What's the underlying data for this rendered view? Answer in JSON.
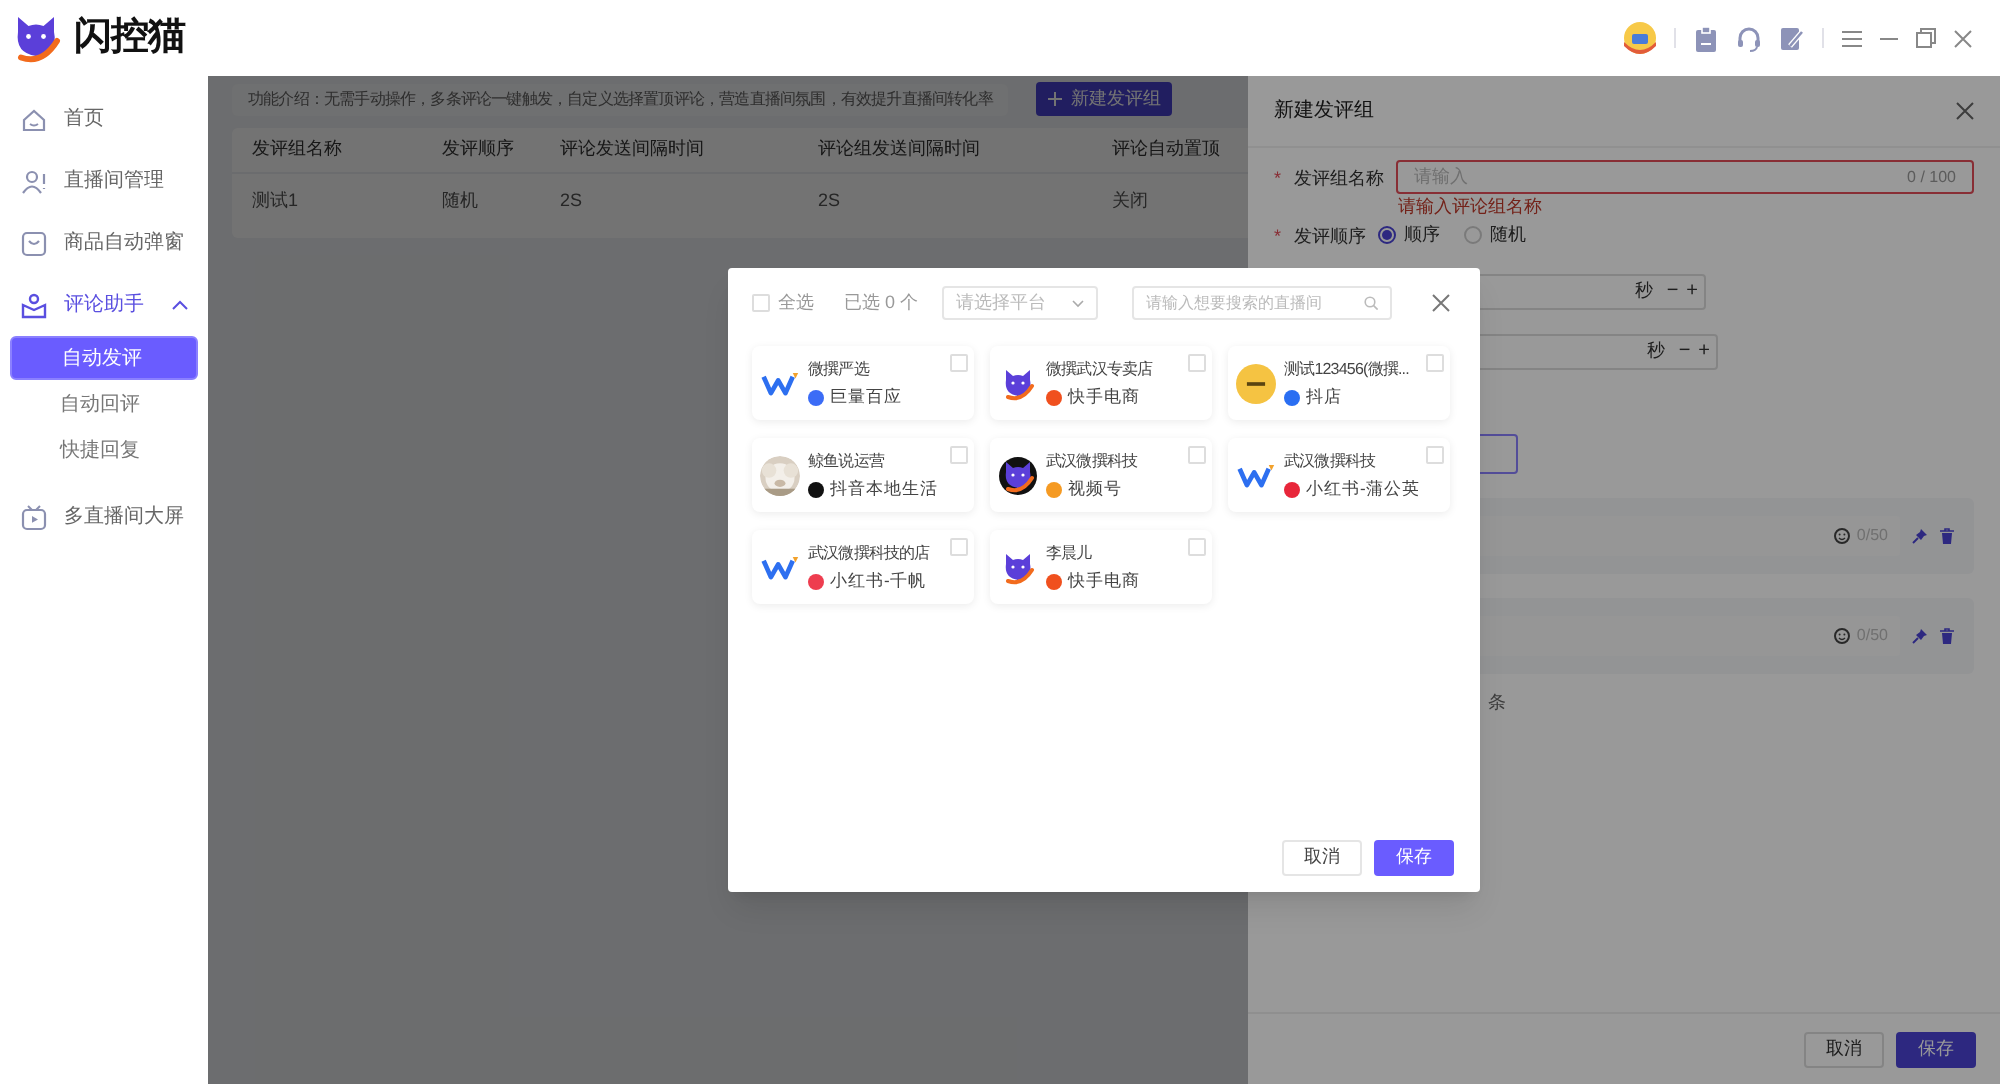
{
  "app": {
    "name": "闪控猫"
  },
  "sidebar": {
    "items": [
      {
        "label": "首页",
        "kind": "link",
        "selected": false
      },
      {
        "label": "直播间管理",
        "kind": "link",
        "selected": false
      },
      {
        "label": "商品自动弹窗",
        "kind": "link",
        "selected": false
      },
      {
        "label": "评论助手",
        "kind": "group",
        "expanded": true,
        "selected": false,
        "children": [
          {
            "label": "自动发评",
            "selected": true
          },
          {
            "label": "自动回评",
            "selected": false
          },
          {
            "label": "快捷回复",
            "selected": false
          }
        ]
      },
      {
        "label": "多直播间大屏",
        "kind": "link",
        "selected": false
      }
    ]
  },
  "main": {
    "notice": "功能介绍：无需手动操作，多条评论一键触发，自定义选择置顶评论，营造直播间氛围，有效提升直播间转化率",
    "new_button": "新建发评组",
    "table": {
      "columns": [
        "发评组名称",
        "发评顺序",
        "评论发送间隔时间",
        "评论组发送间隔时间",
        "评论自动置顶"
      ],
      "rows": [
        [
          "测试1",
          "随机",
          "2S",
          "2S",
          "关闭"
        ]
      ]
    }
  },
  "drawer": {
    "title": "新建发评组",
    "name_field": {
      "required_mark": "*",
      "label": "发评组名称",
      "placeholder": "请输入",
      "counter": "0 / 100",
      "error": "请输入评论组名称"
    },
    "order": {
      "required_mark": "*",
      "label": "发评顺序",
      "options": [
        {
          "label": "顺序",
          "selected": true
        },
        {
          "label": "随机",
          "selected": false
        }
      ]
    },
    "intervals": [
      {
        "unit": "秒",
        "minus": "−",
        "plus": "+"
      },
      {
        "unit": "秒",
        "minus": "−",
        "plus": "+"
      }
    ],
    "comments": [
      {
        "counter": "0/50"
      },
      {
        "counter": "0/50"
      }
    ],
    "fragment": "条",
    "buttons": [
      "取消",
      "保存"
    ]
  },
  "modal": {
    "select_all": {
      "label": "全选",
      "checked": false
    },
    "selected_count": "已选 0 个",
    "platform_select": {
      "placeholder": "请选择平台"
    },
    "search": {
      "placeholder": "请输入想要搜索的直播间"
    },
    "rooms": [
      {
        "name": "微撰严选",
        "platform": "巨量百应",
        "kind": "zigzag",
        "color": "#3b6cf6",
        "checked": false
      },
      {
        "name": "微撰武汉专卖店",
        "platform": "快手电商",
        "kind": "cat",
        "color": "#f0501e",
        "checked": false
      },
      {
        "name": "测试123456(微撰...",
        "platform": "抖店",
        "kind": "badge",
        "color": "#2a6ef2",
        "checked": false
      },
      {
        "name": "鲸鱼说运营",
        "platform": "抖音本地生活",
        "kind": "picture",
        "color": "#111111",
        "checked": false
      },
      {
        "name": "武汉微撰科技",
        "platform": "视频号",
        "kind": "cat-dark",
        "color": "#f59a23",
        "checked": false
      },
      {
        "name": "武汉微撰科技",
        "platform": "小红书-蒲公英",
        "kind": "zigzag",
        "color": "#e8263a",
        "checked": false
      },
      {
        "name": "武汉微撰科技的店",
        "platform": "小红书-千帆",
        "kind": "zigzag",
        "color": "#ee3d4f",
        "checked": false
      },
      {
        "name": "李晨儿",
        "platform": "快手电商",
        "kind": "cat",
        "color": "#f0501e",
        "checked": false
      }
    ],
    "buttons": [
      "取消",
      "保存"
    ]
  }
}
